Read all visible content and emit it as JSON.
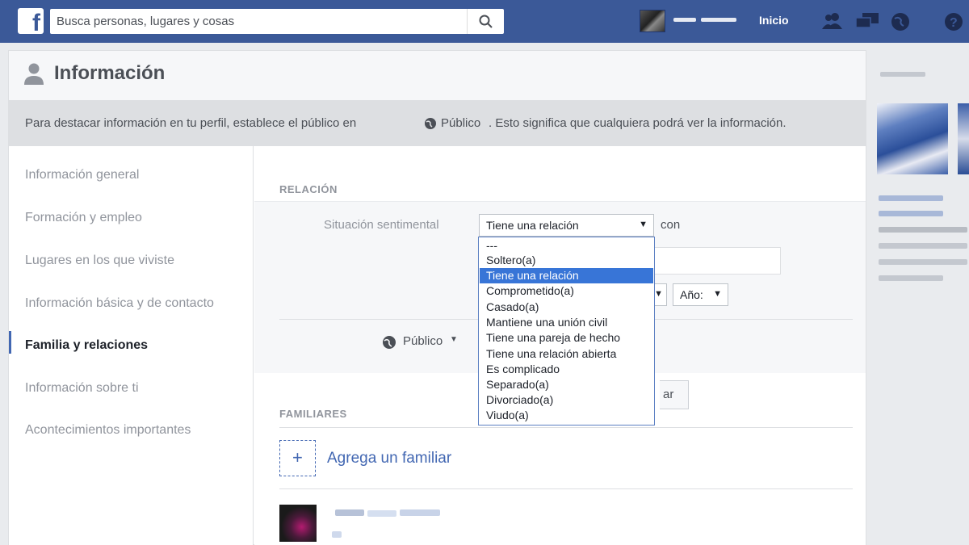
{
  "header": {
    "search_placeholder": "Busca personas, lugares y cosas",
    "home_label": "Inicio",
    "icons": [
      "friends-icon",
      "messages-icon",
      "globe-icon",
      "help-icon"
    ]
  },
  "page": {
    "title": "Información",
    "notice_prefix": "Para destacar información en tu perfil, establece el público en",
    "notice_audience": "Público",
    "notice_suffix": ". Esto significa que cualquiera podrá ver la información."
  },
  "sidebar": {
    "items": [
      {
        "label": "Información general",
        "active": false
      },
      {
        "label": "Formación y empleo",
        "active": false
      },
      {
        "label": "Lugares en los que viviste",
        "active": false
      },
      {
        "label": "Información básica y de contacto",
        "active": false
      },
      {
        "label": "Familia y relaciones",
        "active": true
      },
      {
        "label": "Información sobre ti",
        "active": false
      },
      {
        "label": "Acontecimientos importantes",
        "active": false
      }
    ]
  },
  "relationship": {
    "section_title": "RELACIÓN",
    "status_label": "Situación sentimental",
    "status_value": "Tiene una relación",
    "with_label": "con",
    "year_label": "Año:",
    "privacy_label": "Público",
    "save_label": "ar",
    "options": [
      "---",
      "Soltero(a)",
      "Tiene una relación",
      "Comprometido(a)",
      "Casado(a)",
      "Mantiene una unión civil",
      "Tiene una pareja de hecho",
      "Tiene una relación abierta",
      "Es complicado",
      "Separado(a)",
      "Divorciado(a)",
      "Viudo(a)"
    ],
    "selected_option_index": 2
  },
  "family": {
    "section_title": "FAMILIARES",
    "add_label": "Agrega un familiar",
    "add_icon": "+"
  },
  "colors": {
    "brand_blue": "#3b5998",
    "link_blue": "#4267b2",
    "selection_blue": "#3875d7"
  }
}
